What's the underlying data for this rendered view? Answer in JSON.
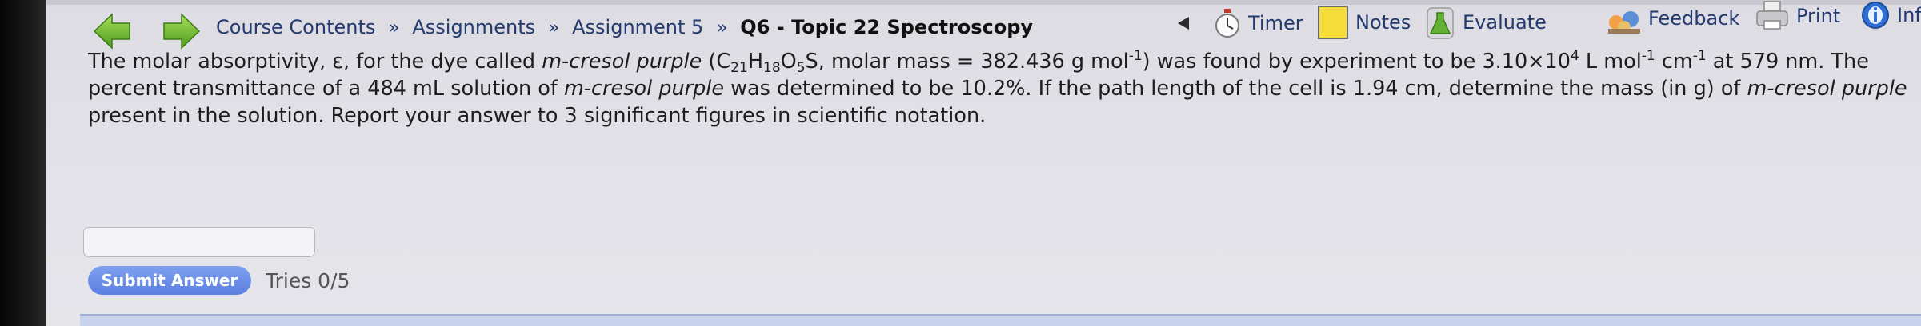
{
  "nav": {
    "back_icon": "green-left-arrow-icon",
    "forward_icon": "green-right-arrow-icon",
    "breadcrumb": {
      "course_contents": "Course Contents",
      "separator": "»",
      "assignments": "Assignments",
      "assignment": "Assignment 5",
      "current": "Q6 - Topic 22 Spectroscopy"
    }
  },
  "toolbar": {
    "timer": "Timer",
    "notes": "Notes",
    "evaluate": "Evaluate",
    "feedback": "Feedback",
    "print": "Print",
    "info": "Info"
  },
  "question": {
    "p1": "The molar absorptivity, ε, for the dye called ",
    "dye_name": "m-cresol purple",
    "f_open": " (C",
    "f_c": "21",
    "f_h_label": "H",
    "f_h": "18",
    "f_o_label": "O",
    "f_o": "5",
    "f_tail": "S, molar mass = 382.436 g mol",
    "exp_neg1": "-1",
    "p2": ") was found by experiment to be 3.10×10",
    "exp_4": "4",
    "p3": " L mol",
    "exp_neg1b": "-1",
    "p4": " cm",
    "exp_neg1c": "-1",
    "p5": " at 579 nm. The percent transmittance of a 484 mL solution of ",
    "dye_name2": "m-cresol purple",
    "p6": " was determined to be 10.2%. If the path length of the cell is 1.94 cm, determine the mass (in g) of ",
    "dye_name3": "m-cresol purple",
    "p7": " present in the solution. Report your answer to 3 significant figures in scientific notation."
  },
  "answer": {
    "value": "",
    "placeholder": ""
  },
  "submit": {
    "label": "Submit Answer",
    "tries": "Tries 0/5"
  },
  "colors": {
    "link": "#223a6d",
    "button": "#6a8ee8",
    "background": "#e2e1e8"
  }
}
